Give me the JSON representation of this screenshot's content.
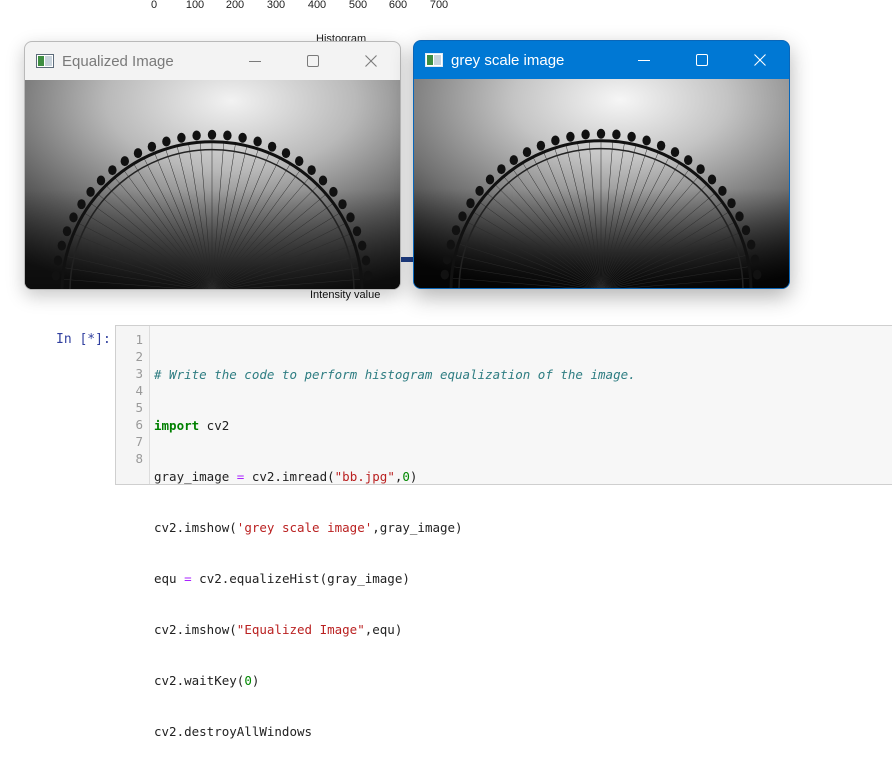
{
  "plot_background": {
    "x_ticks": [
      "0",
      "100",
      "200",
      "300",
      "400",
      "500",
      "600",
      "700"
    ],
    "title": "Histogram",
    "xlabel": "Intensity value"
  },
  "windows": {
    "equalized": {
      "title": "Equalized Image",
      "state": "inactive",
      "image": "equalized ferris wheel photo"
    },
    "grey": {
      "title": "grey scale image",
      "state": "active",
      "image": "greyscale ferris wheel photo"
    }
  },
  "window_controls": [
    "minimize-icon",
    "maximize-icon",
    "close-icon"
  ],
  "colors": {
    "active_titlebar": "#0078d4",
    "inactive_titlebar": "#f3f3f3",
    "prompt": "#303f9f"
  },
  "notebook": {
    "prompt": "In [*]:",
    "line_numbers": [
      "1",
      "2",
      "3",
      "4",
      "5",
      "6",
      "7",
      "8"
    ],
    "code_lines": [
      "# Write the code to perform histogram equalization of the image.",
      "import cv2",
      "gray_image = cv2.imread(\"bb.jpg\",0)",
      "cv2.imshow('grey scale image',gray_image)",
      "equ = cv2.equalizeHist(gray_image)",
      "cv2.imshow(\"Equalized Image\",equ)",
      "cv2.waitKey(0)",
      "cv2.destroyAllWindows"
    ]
  }
}
